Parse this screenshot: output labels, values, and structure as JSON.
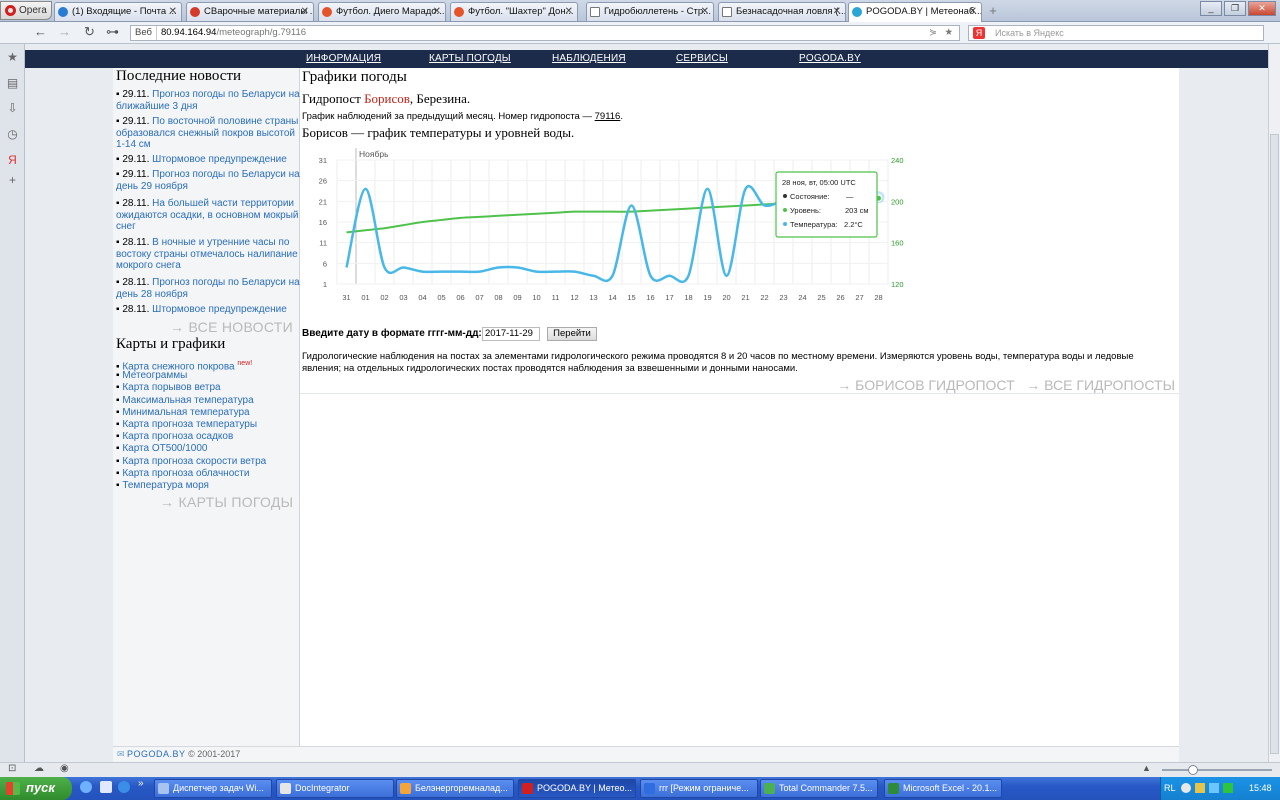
{
  "browser": {
    "menu_label": "Opera",
    "tabs": [
      {
        "label": "(1) Входящие - Почта ...",
        "icon": "mail-icon",
        "color": "#2a7bd4"
      },
      {
        "label": "СВарочные материалы ...",
        "icon": "site-icon",
        "color": "#d43a2a"
      },
      {
        "label": "Футбол. Диего Марадо...",
        "icon": "site-icon",
        "color": "#e4532a"
      },
      {
        "label": "Футбол. \"Шахтер\" Дон...",
        "icon": "site-icon",
        "color": "#e4532a"
      },
      {
        "label": "Гидробюллетень - Стр...",
        "icon": "page-icon",
        "color": "#ffffff"
      },
      {
        "label": "Безнасадочная ловля (...",
        "icon": "page-icon",
        "color": "#ffffff"
      },
      {
        "label": "POGODA.BY | Метеонаб...",
        "icon": "site-icon",
        "color": "#2aa6d4"
      }
    ],
    "url_badge": "Веб",
    "url_host": "80.94.164.94",
    "url_path": "/meteograph/g.79116",
    "search_placeholder": "Искать в Яндекс"
  },
  "topnav": [
    "ИНФОРМАЦИЯ",
    "КАРТЫ ПОГОДЫ",
    "НАБЛЮДЕНИЯ",
    "СЕРВИСЫ",
    "POGODA.BY"
  ],
  "sidebar": {
    "news_title": "Последние новости",
    "news": [
      {
        "date": "29.11.",
        "text": "Прогноз погоды по Беларуси на ближайшие 3 дня"
      },
      {
        "date": "29.11.",
        "text": "По восточной половине страны образовался снежный покров высотой 1-14 см"
      },
      {
        "date": "29.11.",
        "text": "Штормовое предупреждение"
      },
      {
        "date": "29.11.",
        "text": "Прогноз погоды по Беларуси на день 29 ноября"
      },
      {
        "date": "28.11.",
        "text": "На большей части территории ожидаются осадки, в основном мокрый снег"
      },
      {
        "date": "28.11.",
        "text": "В ночные и утренние часы по востоку страны отмечалось налипание мокрого снега"
      },
      {
        "date": "28.11.",
        "text": "Прогноз погоды по Беларуси на день 28 ноября"
      },
      {
        "date": "28.11.",
        "text": "Штормовое предупреждение"
      }
    ],
    "all_news": "→ ВСЕ НОВОСТИ",
    "maps_title": "Карты и графики",
    "maps": [
      "Карта снежного покрова",
      "Метеограммы",
      "Карта порывов ветра",
      "Максимальная температура",
      "Минимальная температура",
      "Карта прогноза температуры",
      "Карта прогноза осадков",
      "Карта ОТ500/1000",
      "Карта прогноза скорости ветра",
      "Карта прогноза облачности",
      "Температура моря"
    ],
    "new_badge": "new!",
    "all_maps": "→ КАРТЫ ПОГОДЫ"
  },
  "main": {
    "title": "Графики погоды",
    "post_prefix": "Гидропост ",
    "post_city": "Борисов",
    "post_river": ", Березина.",
    "desc_text": "График наблюдений за предыдущий месяц. Номер гидропоста — ",
    "post_number": "79116",
    "desc_end": ".",
    "chart_title": "Борисов — график температуры и уровней воды.",
    "date_label": "Введите дату в формате гггг-мм-дд:",
    "date_value": "2017-11-29",
    "go_button": "Перейти",
    "info": "Гидрологические наблюдения на постах за элементами гидрологического режима проводятся 8 и 20 часов по местному времени. Измеряются уровень воды, температура воды и ледовые явления; на отдельных гидрологических постах проводятся наблюдения за взвешенными и донными наносами.",
    "link_borisov": "→ БОРИСОВ ГИДРОПОСТ",
    "link_all": "→ ВСЕ ГИДРОПОСТЫ"
  },
  "footer": {
    "brand": "POGODA.BY",
    "copy": " © 2001-2017"
  },
  "chart_data": {
    "type": "line",
    "month_label": "Ноябрь",
    "x": [
      "31",
      "01",
      "02",
      "03",
      "04",
      "05",
      "06",
      "07",
      "08",
      "09",
      "10",
      "11",
      "12",
      "13",
      "14",
      "15",
      "16",
      "17",
      "18",
      "19",
      "20",
      "21",
      "22",
      "23",
      "24",
      "25",
      "26",
      "27",
      "28"
    ],
    "series": [
      {
        "name": "Уровень",
        "axis": "right",
        "color": "#4ec24a",
        "values": [
          170,
          172,
          174,
          177,
          180,
          182,
          184,
          185,
          186,
          187,
          188,
          189,
          190,
          190,
          190,
          190,
          191,
          192,
          193,
          194,
          195,
          196,
          197,
          198,
          199,
          200,
          201,
          202,
          203
        ]
      },
      {
        "name": "Температура",
        "axis": "left",
        "color": "#47b8e8",
        "values": [
          5,
          24,
          5,
          5,
          4,
          4,
          4,
          4,
          5,
          5,
          4,
          4,
          4,
          3,
          3,
          20,
          3,
          3,
          3,
          24,
          3,
          24,
          20,
          21,
          20,
          20,
          20,
          21,
          22
        ]
      }
    ],
    "y_left_ticks": [
      "31",
      "26",
      "21",
      "16",
      "11",
      "6",
      "1"
    ],
    "y_left_range": [
      1,
      31
    ],
    "y_right_ticks": [
      "240",
      "200",
      "160",
      "120"
    ],
    "y_right_range": [
      120,
      240
    ],
    "tooltip": {
      "date": "28 ноя, вт, 05:00 UTC",
      "state_label": "Состояние:",
      "state_value": "—",
      "level_label": "Уровень:",
      "level_value": "203 см",
      "temp_label": "Температура:",
      "temp_value": "2.2°C"
    }
  },
  "taskbar": {
    "start": "пуск",
    "items": [
      "Диспетчер задач Wi...",
      "DocIntegrator",
      "Белэнергоремналад...",
      "POGODA.BY | Метео...",
      "rrr [Режим ограниче...",
      "Total Commander 7.5...",
      "Microsoft Excel - 20.1..."
    ],
    "lang": "RL",
    "time": "15:48"
  }
}
